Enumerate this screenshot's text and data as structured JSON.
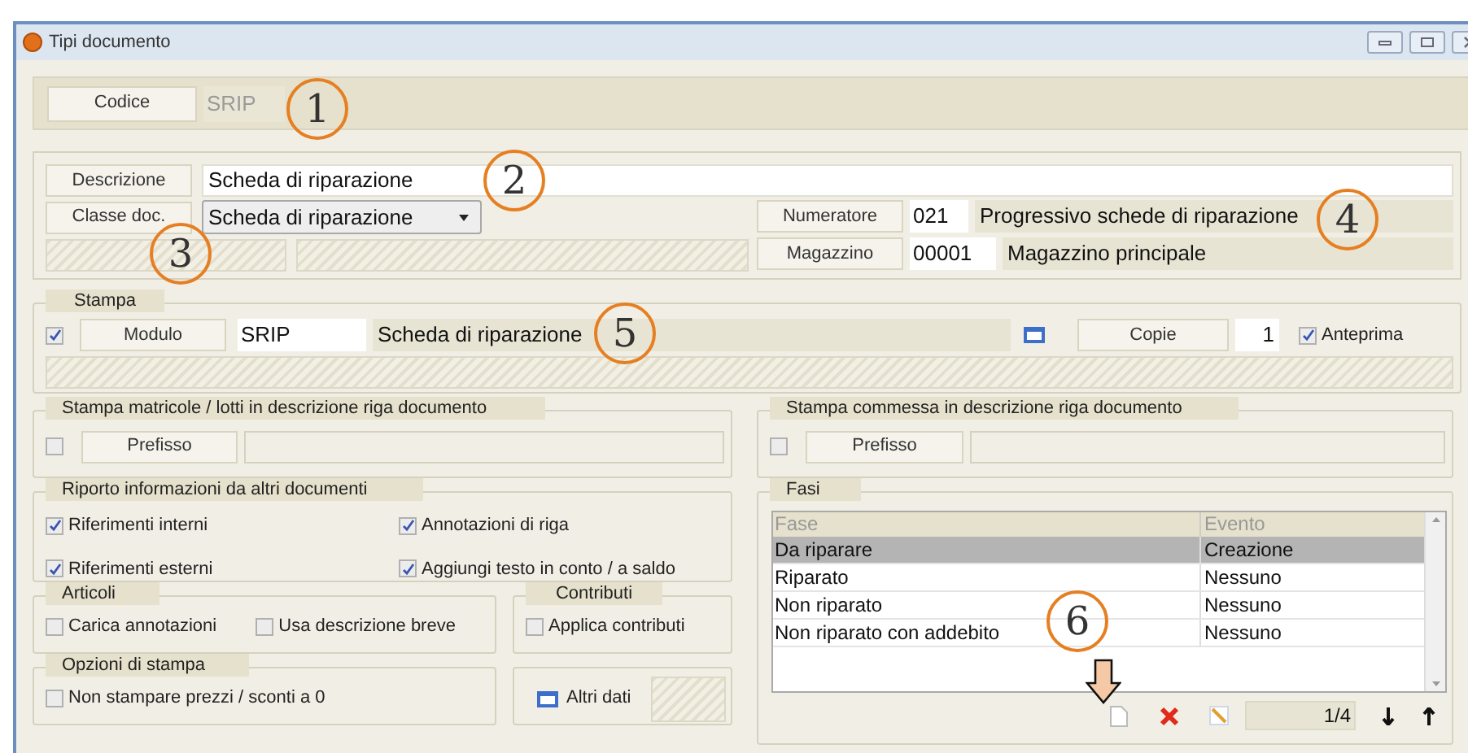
{
  "window": {
    "title": "Tipi documento"
  },
  "codice": {
    "label": "Codice",
    "value": "SRIP"
  },
  "descrizione": {
    "label": "Descrizione",
    "value": "Scheda di riparazione"
  },
  "classe_doc": {
    "label": "Classe doc.",
    "value": "Scheda di riparazione"
  },
  "numeratore": {
    "label": "Numeratore",
    "code": "021",
    "description": "Progressivo schede di riparazione"
  },
  "magazzino": {
    "label": "Magazzino",
    "code": "00001",
    "description": "Magazzino principale"
  },
  "stampa": {
    "title": "Stampa",
    "checked": true,
    "modulo_label": "Modulo",
    "modulo_code": "SRIP",
    "modulo_description": "Scheda di riparazione",
    "copie_label": "Copie",
    "copie_value": "1",
    "anteprima": {
      "label": "Anteprima",
      "checked": true
    }
  },
  "stampa_matricole": {
    "title": "Stampa matricole / lotti in descrizione riga documento",
    "checked": false,
    "prefisso_label": "Prefisso"
  },
  "stampa_commessa": {
    "title": "Stampa commessa in descrizione riga documento",
    "checked": false,
    "prefisso_label": "Prefisso"
  },
  "riporto": {
    "title": "Riporto informazioni da altri documenti",
    "options": [
      {
        "label": "Riferimenti interni",
        "checked": true
      },
      {
        "label": "Annotazioni di riga",
        "checked": true
      },
      {
        "label": "Riferimenti esterni",
        "checked": true
      },
      {
        "label": "Aggiungi testo in conto / a saldo",
        "checked": true
      }
    ]
  },
  "articoli": {
    "title": "Articoli",
    "options": [
      {
        "label": "Carica annotazioni",
        "checked": false
      },
      {
        "label": "Usa descrizione breve",
        "checked": false
      }
    ]
  },
  "contributi": {
    "title": "Contributi",
    "options": [
      {
        "label": "Applica contributi",
        "checked": false
      }
    ]
  },
  "opzioni_stampa": {
    "title": "Opzioni di stampa",
    "options": [
      {
        "label": "Non stampare prezzi / sconti a 0",
        "checked": false
      }
    ]
  },
  "altri_dati": {
    "label": "Altri dati"
  },
  "fasi": {
    "title": "Fasi",
    "columns": [
      "Fase",
      "Evento"
    ],
    "rows": [
      {
        "fase": "Da riparare",
        "evento": "Creazione",
        "selected": true
      },
      {
        "fase": "Riparato",
        "evento": "Nessuno",
        "selected": false
      },
      {
        "fase": "Non riparato",
        "evento": "Nessuno",
        "selected": false
      },
      {
        "fase": "Non riparato con addebito",
        "evento": "Nessuno",
        "selected": false
      }
    ],
    "pager": "1/4"
  },
  "callouts": [
    "1",
    "2",
    "3",
    "4",
    "5",
    "6"
  ]
}
